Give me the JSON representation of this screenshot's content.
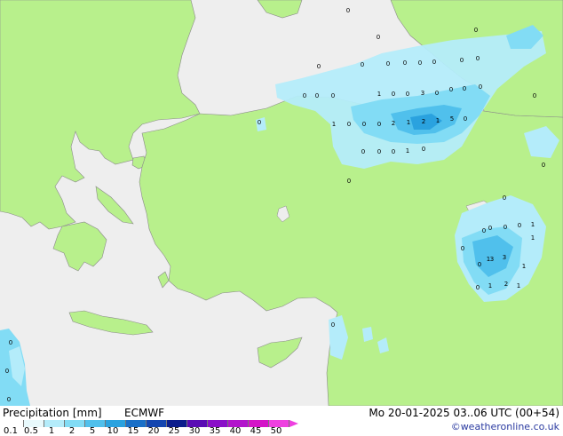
{
  "map": {
    "colors": {
      "land": "#b8f08c",
      "sea": "#eeeeee",
      "coast": "#8a8a8a",
      "precip_light": "#b4ecfa",
      "precip_mid": "#82dcf5",
      "precip_heavy": "#50c0ec",
      "precip_strong": "#2aa2df"
    },
    "values": [
      {
        "t": "0"
      },
      {
        "t": "0"
      },
      {
        "t": "0"
      },
      {
        "t": "0"
      },
      {
        "t": "0"
      },
      {
        "t": "0"
      },
      {
        "t": "0"
      },
      {
        "t": "0"
      },
      {
        "t": "0"
      },
      {
        "t": "0"
      },
      {
        "t": "0"
      },
      {
        "t": "0"
      },
      {
        "t": "0"
      },
      {
        "t": "0"
      },
      {
        "t": "1"
      },
      {
        "t": "0"
      },
      {
        "t": "0"
      },
      {
        "t": "3"
      },
      {
        "t": "0"
      },
      {
        "t": "0"
      },
      {
        "t": "0"
      },
      {
        "t": "0"
      },
      {
        "t": "1"
      },
      {
        "t": "0"
      },
      {
        "t": "0"
      },
      {
        "t": "0"
      },
      {
        "t": "2"
      },
      {
        "t": "1"
      },
      {
        "t": "2"
      },
      {
        "t": "1"
      },
      {
        "t": "5"
      },
      {
        "t": "0"
      },
      {
        "t": "0"
      },
      {
        "t": "0"
      },
      {
        "t": "0"
      },
      {
        "t": "1"
      },
      {
        "t": "0"
      },
      {
        "t": "0"
      },
      {
        "t": "0"
      },
      {
        "t": "0"
      },
      {
        "t": "0"
      },
      {
        "t": "0"
      },
      {
        "t": "0"
      },
      {
        "t": "1"
      },
      {
        "t": "0"
      },
      {
        "t": "1"
      },
      {
        "t": "3"
      },
      {
        "t": "1"
      },
      {
        "t": "0"
      },
      {
        "t": "1"
      },
      {
        "t": "2"
      },
      {
        "t": "1"
      },
      {
        "t": "0"
      },
      {
        "t": "0"
      },
      {
        "t": "0"
      },
      {
        "t": "1"
      },
      {
        "t": "0"
      },
      {
        "t": "0"
      },
      {
        "t": "0"
      },
      {
        "t": "0"
      },
      {
        "t": "0"
      },
      {
        "t": "3"
      }
    ]
  },
  "legend": {
    "title": "Precipitation [mm]",
    "model": "ECMWF",
    "scale": [
      {
        "label": "0.1",
        "color": "#ffffff"
      },
      {
        "label": "0.5",
        "color": "#e8f9fc"
      },
      {
        "label": "1",
        "color": "#b4ecfa"
      },
      {
        "label": "2",
        "color": "#82dcf5"
      },
      {
        "label": "5",
        "color": "#50c0ec"
      },
      {
        "label": "10",
        "color": "#2aa2df"
      },
      {
        "label": "15",
        "color": "#1a70c8"
      },
      {
        "label": "20",
        "color": "#1446b0"
      },
      {
        "label": "25",
        "color": "#0c1e8c"
      },
      {
        "label": "30",
        "color": "#5a0cb4"
      },
      {
        "label": "35",
        "color": "#8a10c8"
      },
      {
        "label": "40",
        "color": "#b214cc"
      },
      {
        "label": "45",
        "color": "#d414c8"
      },
      {
        "label": "50",
        "color": "#ee40e0"
      }
    ]
  },
  "footer": {
    "valid_time": "Mo 20-01-2025 03..06 UTC (00+54)",
    "credit": "©weatheronline.co.uk"
  }
}
